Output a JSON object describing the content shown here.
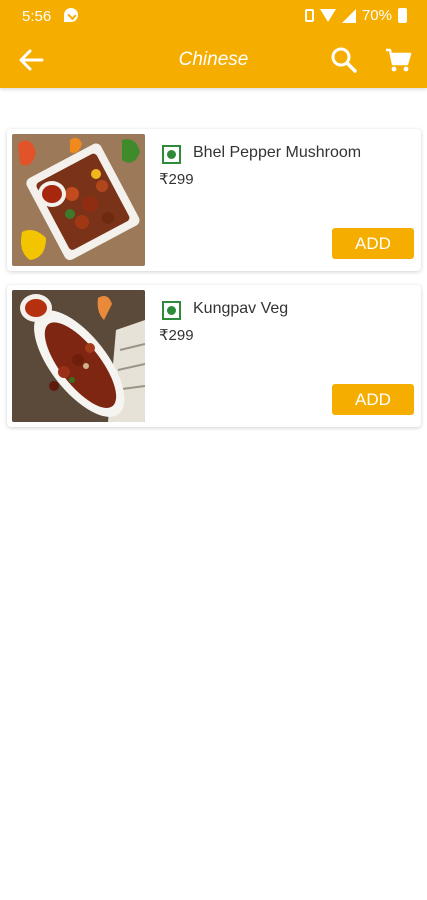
{
  "status_bar": {
    "time": "5:56",
    "battery": "70%"
  },
  "app_bar": {
    "title": "Chinese",
    "back_icon": "arrow-left-icon",
    "search_icon": "search-icon",
    "cart_icon": "cart-icon"
  },
  "colors": {
    "accent": "#f5ad00",
    "veg_green": "#2e8b3a",
    "text": "#333333",
    "background": "#ffffff"
  },
  "items": [
    {
      "name": "Bhel Pepper Mushroom",
      "price": "₹299",
      "veg_icon": "veg-indicator-icon",
      "add_label": "ADD"
    },
    {
      "name": "Kungpav Veg",
      "price": "₹299",
      "veg_icon": "veg-indicator-icon",
      "add_label": "ADD"
    }
  ]
}
